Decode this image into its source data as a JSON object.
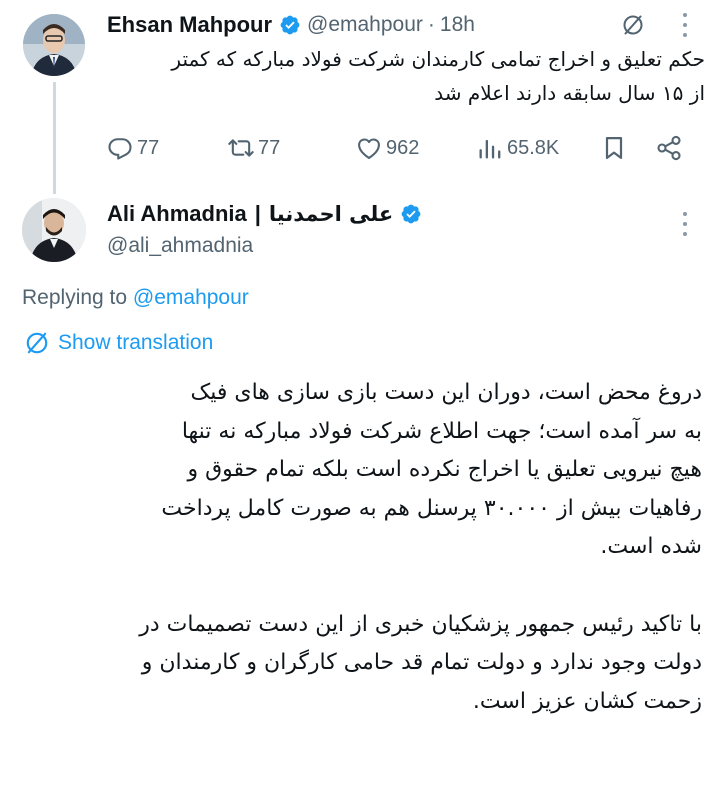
{
  "tweet1": {
    "name": "Ehsan Mahpour",
    "handle": "@emahpour",
    "separator": "·",
    "time": "18h",
    "text_lines": [
      "حکم تعلیق و اخراج تمامی کارمندان شرکت فولاد مبارکه که کمتر",
      "از ۱۵ سال سابقه دارند اعلام شد"
    ],
    "stats": {
      "replies": "77",
      "reposts": "77",
      "likes": "962",
      "views": "65.8K"
    }
  },
  "tweet2": {
    "name": "Ali Ahmadnia",
    "name_separator": "|",
    "name_fa": "علی احمدنیا",
    "handle": "@ali_ahmadnia",
    "replying_label": "Replying to",
    "replying_handle": "@emahpour",
    "show_translation": "Show translation",
    "paragraph1_lines": [
      "دروغ محض است، دوران این دست بازی سازی های فیک",
      "به سر آمده است؛ جهت اطلاع شرکت فولاد مبارکه نه تنها",
      "هیچ نیرویی تعلیق یا اخراج نکرده است بلکه تمام  حقوق و",
      "رفاهیات بیش از ۳۰.۰۰۰ پرسنل هم به صورت کامل پرداخت",
      "شده است."
    ],
    "paragraph2_lines": [
      "با تاکید رئیس جمهور پزشکیان خبری از این دست تصمیمات در",
      "دولت وجود ندارد و دولت تمام قد حامی کارگران و کارمندان و",
      "زحمت کشان عزیز است."
    ]
  },
  "icons": {
    "verified": "verified-badge-icon",
    "grok": "grok-icon",
    "more": "more-icon",
    "reply": "reply-icon",
    "repost": "repost-icon",
    "like": "heart-icon",
    "views": "views-icon",
    "bookmark": "bookmark-icon",
    "share": "share-icon",
    "translate": "translate-icon"
  },
  "colors": {
    "text": "#0f1419",
    "muted": "#536471",
    "accent": "#1d9bf0",
    "thread_line": "#cfd9de"
  }
}
